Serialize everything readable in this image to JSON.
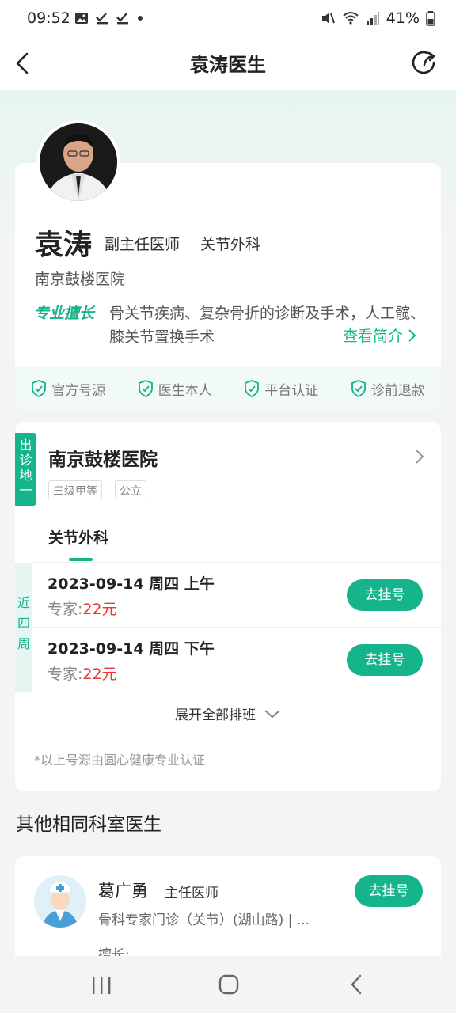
{
  "status_bar": {
    "time": "09:52",
    "battery": "41%"
  },
  "header": {
    "title": "袁涛医生"
  },
  "doctor": {
    "name": "袁涛",
    "title": "副主任医师",
    "department": "关节外科",
    "hospital": "南京鼓楼医院",
    "specialty_label": "专业擅长",
    "specialty_text": "骨关节疾病、复杂骨折的诊断及手术，人工髋、膝关节置换手术",
    "intro_link": "查看简介"
  },
  "badges": [
    "官方号源",
    "医生本人",
    "平台认证",
    "诊前退款"
  ],
  "clinic": {
    "location_tag": "出诊地一",
    "hospital": "南京鼓楼医院",
    "tags": [
      "三级甲等",
      "公立"
    ],
    "dept_tab": "关节外科",
    "week_label": "近四周",
    "slots": [
      {
        "date": "2023-09-14  周四  上午",
        "price_label": "专家:",
        "price": "22元",
        "button": "去挂号"
      },
      {
        "date": "2023-09-14  周四  下午",
        "price_label": "专家:",
        "price": "22元",
        "button": "去挂号"
      }
    ],
    "expand_label": "展开全部排班",
    "note": "*以上号源由圆心健康专业认证"
  },
  "other": {
    "section_title": "其他相同科室医生",
    "doctor": {
      "name": "葛广勇",
      "title": "主任医师",
      "department": "骨科专家门诊（关节）(湖山路) | ...",
      "specialty_label": "擅长:",
      "button": "去挂号"
    }
  },
  "colors": {
    "accent": "#15b48a",
    "price": "#ee3333"
  }
}
